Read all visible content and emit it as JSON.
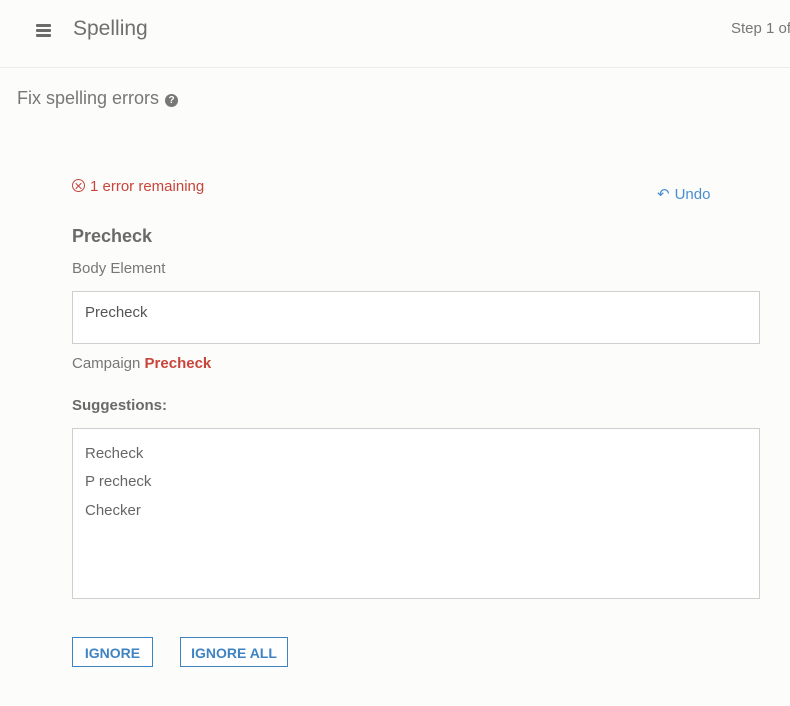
{
  "header": {
    "title": "Spelling",
    "step": "Step 1 of"
  },
  "section": {
    "title": "Fix spelling errors"
  },
  "status": {
    "error_text": "1 error remaining",
    "undo_label": "Undo"
  },
  "word": {
    "heading": "Precheck",
    "element_label": "Body Element",
    "box_text": "Precheck",
    "context_prefix": "Campaign",
    "context_word": "Precheck"
  },
  "suggestions": {
    "label": "Suggestions:",
    "items": [
      "Recheck",
      "P recheck",
      "Checker"
    ]
  },
  "buttons": {
    "ignore": "IGNORE",
    "ignore_all": "IGNORE ALL"
  },
  "colors": {
    "error": "#c9453b",
    "accent": "#3f83c2",
    "link": "#4a8fd0"
  },
  "icons": {
    "menu": "hamburger-menu-icon",
    "help": "help-circle-icon",
    "error": "error-circle-icon",
    "undo": "undo-arrow-icon"
  }
}
